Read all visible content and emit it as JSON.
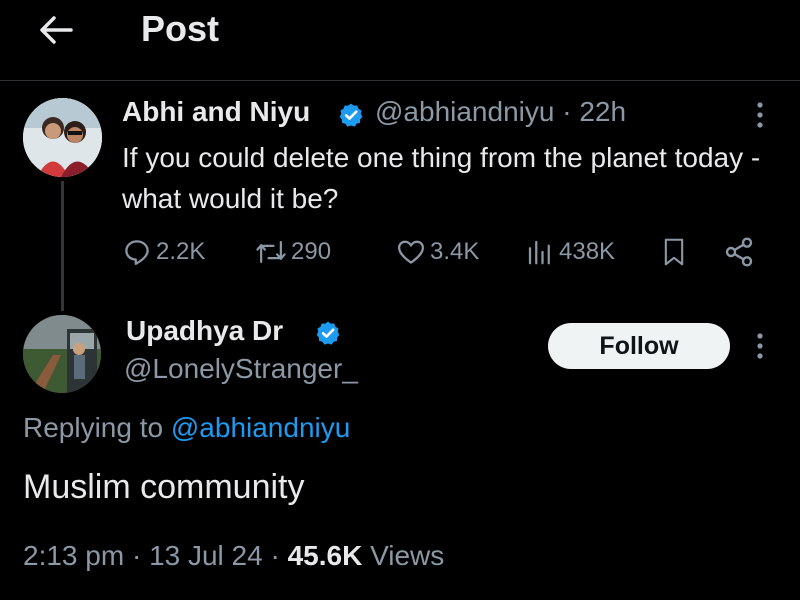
{
  "header": {
    "title": "Post",
    "back_icon": "arrow-left-icon"
  },
  "parent_post": {
    "name": "Abhi and Niyu",
    "handle": "@abhiandniyu",
    "separator": " · ",
    "time": "22h",
    "text": "If you could delete one thing from the planet today - what would it be?",
    "verified_color": "#1d9bf0",
    "stats": {
      "replies": "2.2K",
      "reposts": "290",
      "likes": "3.4K",
      "views": "438K"
    }
  },
  "reply_post": {
    "name": "Upadhya Dr",
    "handle": "@LonelyStranger_",
    "follow_label": "Follow",
    "replying_prefix": "Replying to ",
    "replying_to": "@abhiandniyu",
    "text": "Muslim community",
    "time": "2:13 pm",
    "sep1": " · ",
    "date": "13 Jul 24",
    "sep2": " · ",
    "views_count": "45.6K",
    "views_label": " Views"
  },
  "colors": {
    "background": "#000000",
    "text": "#e7e9ea",
    "muted": "#8b98a5",
    "link": "#1d9bf0"
  }
}
